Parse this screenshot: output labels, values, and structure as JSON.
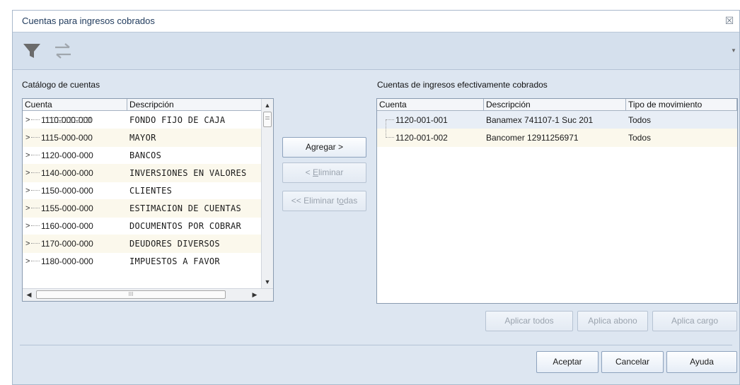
{
  "window": {
    "title": "Cuentas para ingresos cobrados",
    "close_glyph": "☒"
  },
  "toolbar": {
    "filter_icon": "filter-icon",
    "swap_icon": "swap-arrows-icon",
    "dropdown_glyph": "▼"
  },
  "left": {
    "label": "Catálogo de cuentas",
    "columns": [
      "Cuenta",
      "Descripción"
    ],
    "rows": [
      {
        "cuenta": "1110-000-000",
        "descripcion": "FONDO FIJO DE CAJA"
      },
      {
        "cuenta": "1115-000-000",
        "descripcion": "MAYOR"
      },
      {
        "cuenta": "1120-000-000",
        "descripcion": "BANCOS"
      },
      {
        "cuenta": "1140-000-000",
        "descripcion": "INVERSIONES EN VALORES"
      },
      {
        "cuenta": "1150-000-000",
        "descripcion": "CLIENTES"
      },
      {
        "cuenta": "1155-000-000",
        "descripcion": "ESTIMACION DE CUENTAS"
      },
      {
        "cuenta": "1160-000-000",
        "descripcion": "DOCUMENTOS POR COBRAR"
      },
      {
        "cuenta": "1170-000-000",
        "descripcion": "DEUDORES DIVERSOS"
      },
      {
        "cuenta": "1180-000-000",
        "descripcion": "IMPUESTOS A FAVOR"
      }
    ],
    "hscroll_grip": "III"
  },
  "middle": {
    "agregar": "Agregar >",
    "eliminar_pre": "< ",
    "eliminar_key": "E",
    "eliminar_post": "liminar",
    "eliminar_todas_pre": "<< Eliminar t",
    "eliminar_todas_key": "o",
    "eliminar_todas_post": "das"
  },
  "right": {
    "label": "Cuentas de ingresos efectivamente cobrados",
    "columns": [
      "Cuenta",
      "Descripción",
      "Tipo de movimiento"
    ],
    "rows": [
      {
        "cuenta": "1120-001-001",
        "descripcion": "Banamex 741107-1 Suc 201",
        "tipo": "Todos"
      },
      {
        "cuenta": "1120-001-002",
        "descripcion": "Bancomer 12911256971",
        "tipo": "Todos"
      }
    ]
  },
  "apply_buttons": {
    "todos": "Aplicar todos",
    "abono": "Aplica abono",
    "cargo": "Aplica cargo"
  },
  "footer": {
    "aceptar": "Aceptar",
    "cancelar": "Cancelar",
    "ayuda": "Ayuda"
  }
}
